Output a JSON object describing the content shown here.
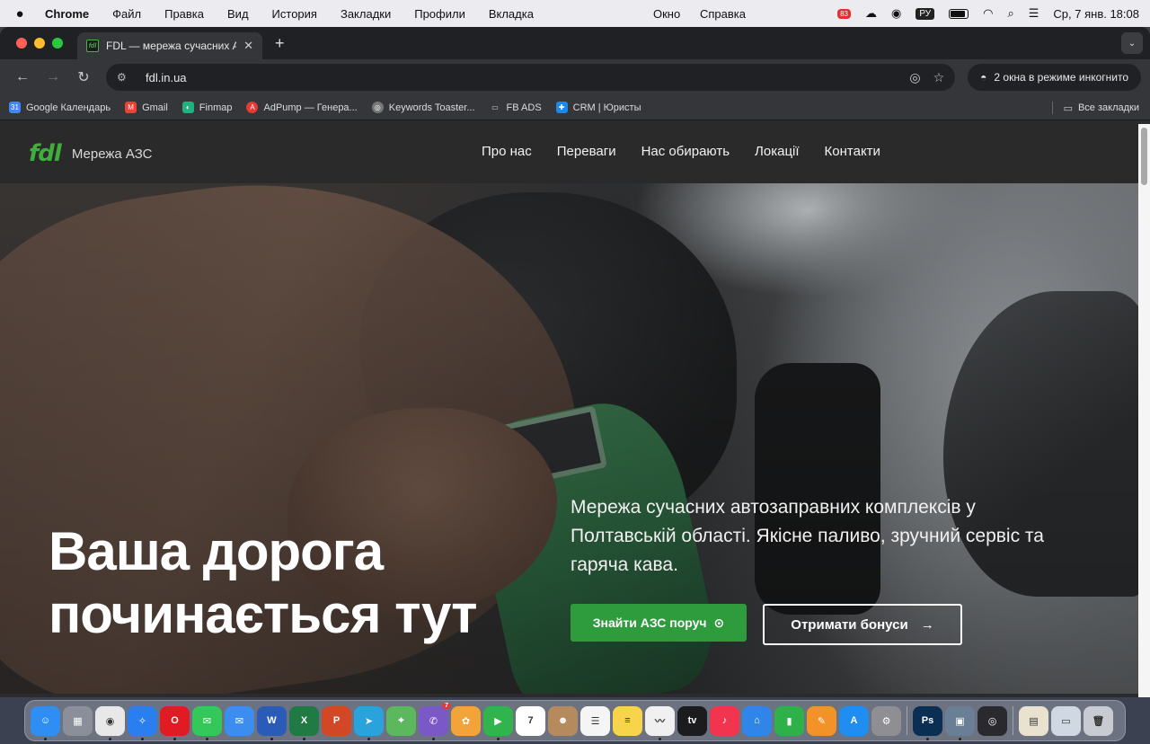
{
  "menubar": {
    "app_name": "Chrome",
    "items": [
      "Файл",
      "Правка",
      "Вид",
      "История",
      "Закладки",
      "Профили",
      "Вкладка",
      "Окно",
      "Справка"
    ],
    "badge": "83",
    "keyboard": "РУ",
    "datetime": "Ср, 7 янв.  18:08"
  },
  "browser": {
    "tab_title": "FDL — мережа сучасних АЗС",
    "favicon_text": "fdl",
    "url": "fdl.in.ua",
    "incognito_label": "2 окна в режиме инкогнито",
    "bookmarks": [
      {
        "label": "Google Календарь",
        "color": "#4285f4",
        "glyph": "31"
      },
      {
        "label": "Gmail",
        "color": "#ea4335",
        "glyph": "M"
      },
      {
        "label": "Finmap",
        "color": "#22b07d",
        "glyph": "◐"
      },
      {
        "label": "AdPump — Генера...",
        "color": "#e53935",
        "glyph": "A"
      },
      {
        "label": "Keywords Toaster...",
        "color": "#777777",
        "glyph": "◎"
      },
      {
        "label": "FB ADS",
        "color": "transparent",
        "glyph": "▭"
      },
      {
        "label": "CRM | Юристы",
        "color": "#1e88e5",
        "glyph": "✚"
      }
    ],
    "all_bookmarks": "Все закладки"
  },
  "site": {
    "logo_mark": "fdl",
    "logo_text": "Мережа АЗС",
    "nav": [
      "Про нас",
      "Переваги",
      "Нас обирають",
      "Локації",
      "Контакти"
    ],
    "headline_line1": "Ваша дорога",
    "headline_line2": "починається тут",
    "subtext": "Мережа сучасних автозаправних комплексів у Полтавській області. Якісне паливо, зручний сервіс та гаряча кава.",
    "primary_button": "Знайти АЗС поруч",
    "secondary_button": "Отримати бонуси"
  },
  "dock": {
    "apps": [
      {
        "name": "finder",
        "color": "#2f8ef4",
        "glyph": "☺"
      },
      {
        "name": "launchpad",
        "color": "#8a8f99",
        "glyph": "▦"
      },
      {
        "name": "chrome",
        "color": "#e8e8e8",
        "glyph": "◉"
      },
      {
        "name": "safari",
        "color": "#2a7ff0",
        "glyph": "✧"
      },
      {
        "name": "opera",
        "color": "#e01b24",
        "glyph": "O"
      },
      {
        "name": "messages",
        "color": "#34c759",
        "glyph": "✉"
      },
      {
        "name": "mail",
        "color": "#3b8ef0",
        "glyph": "✉"
      },
      {
        "name": "word",
        "color": "#2b5bb8",
        "glyph": "W"
      },
      {
        "name": "excel",
        "color": "#1f7a43",
        "glyph": "X"
      },
      {
        "name": "powerpoint",
        "color": "#d24726",
        "glyph": "P"
      },
      {
        "name": "telegram",
        "color": "#2aa3dd",
        "glyph": "➤"
      },
      {
        "name": "maps",
        "color": "#5cb85c",
        "glyph": "⌖"
      },
      {
        "name": "viber",
        "color": "#7b58c8",
        "glyph": "✆",
        "badge": "7"
      },
      {
        "name": "photos",
        "color": "#f2a33a",
        "glyph": "✿"
      },
      {
        "name": "facetime",
        "color": "#31b44b",
        "glyph": "▶"
      },
      {
        "name": "calendar",
        "color": "#ffffff",
        "glyph": "7"
      },
      {
        "name": "contacts",
        "color": "#b58b5e",
        "glyph": "☻"
      },
      {
        "name": "reminders",
        "color": "#f5f5f5",
        "glyph": "☰"
      },
      {
        "name": "notes",
        "color": "#f7d44a",
        "glyph": "≡"
      },
      {
        "name": "freeform",
        "color": "#f0f0f0",
        "glyph": "〰"
      },
      {
        "name": "appletv",
        "color": "#1c1c1e",
        "glyph": "tv"
      },
      {
        "name": "music",
        "color": "#f3344f",
        "glyph": "♪"
      },
      {
        "name": "keynote",
        "color": "#2f86e8",
        "glyph": "⌂"
      },
      {
        "name": "numbers",
        "color": "#2fb14a",
        "glyph": "▮"
      },
      {
        "name": "pages",
        "color": "#f4922a",
        "glyph": "✎"
      },
      {
        "name": "appstore",
        "color": "#1f8ef0",
        "glyph": "A"
      },
      {
        "name": "settings",
        "color": "#8e8e93",
        "glyph": "⚙"
      },
      {
        "name": "photoshop",
        "color": "#0b2f53",
        "glyph": "Ps"
      },
      {
        "name": "preview",
        "color": "#6a7f95",
        "glyph": "▣"
      },
      {
        "name": "quicktime",
        "color": "#2a2a2e",
        "glyph": "◎"
      },
      {
        "name": "documents",
        "color": "#e9e2cf",
        "glyph": "▤"
      },
      {
        "name": "downloads",
        "color": "#cfd8e3",
        "glyph": "▭"
      },
      {
        "name": "trash",
        "color": "#c8ccd2",
        "glyph": "🗑"
      }
    ]
  }
}
